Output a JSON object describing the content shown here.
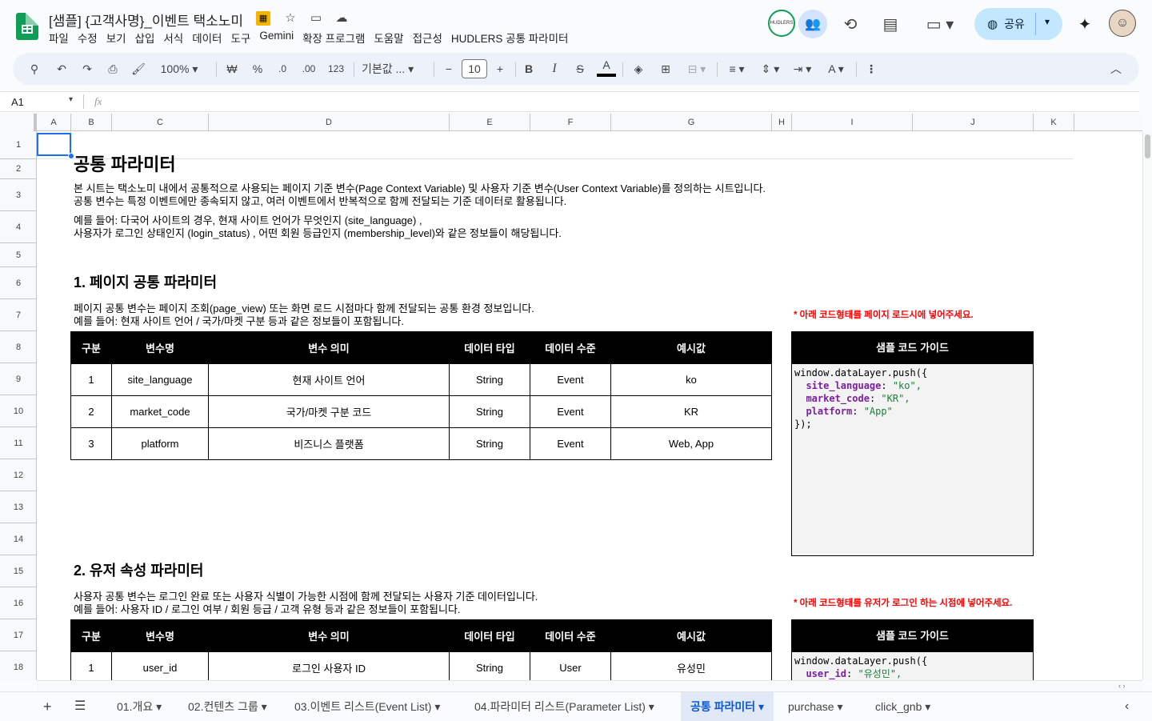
{
  "doc": {
    "title": "[샘플] {고객사명}_이벤트 택소노미"
  },
  "menu": [
    "파일",
    "수정",
    "보기",
    "삽입",
    "서식",
    "데이터",
    "도구",
    "Gemini",
    "확장 프로그램",
    "도움말",
    "접근성",
    "HUDLERS 공통 파라미터"
  ],
  "header_right": {
    "share_label": "공유",
    "avatar_badge": "HUDLERS"
  },
  "toolbar": {
    "zoom": "100%",
    "currency": "₩",
    "percent": "%",
    "dec_less": ".0",
    "dec_more": ".00",
    "format_more": "123",
    "font": "기본값 ...",
    "font_size": "10"
  },
  "formula": {
    "namebox": "A1",
    "fx": "fx"
  },
  "columns": [
    "A",
    "B",
    "C",
    "D",
    "E",
    "F",
    "G",
    "H",
    "I",
    "J",
    "K"
  ],
  "rows": [
    "1",
    "2",
    "3",
    "4",
    "5",
    "6",
    "7",
    "8",
    "9",
    "10",
    "11",
    "12",
    "13",
    "14",
    "15",
    "16",
    "17",
    "18"
  ],
  "content": {
    "title": "공통 파라미터",
    "intro1": "본 시트는 택소노미 내에서 공통적으로 사용되는 페이지 기준 변수(Page Context Variable) 및 사용자 기준 변수(User Context Variable)를 정의하는 시트입니다.",
    "intro2": "공통 변수는 특정 이벤트에만 종속되지 않고, 여러 이벤트에서 반복적으로 함께 전달되는 기준 데이터로 활용됩니다.",
    "example1": "예를 들어: 다국어 사이트의 경우, 현재 사이트 언어가 무엇인지 (site_language) ,",
    "example2": "사용자가 로그인 상태인지 (login_status) , 어떤 회원 등급인지 (membership_level)와 같은 정보들이 해당됩니다.",
    "section1": {
      "heading": "1. 페이지 공통 파라미터",
      "desc1": "페이지 공통 변수는 페이지 조회(page_view) 또는 화면 로드 시점마다 함께 전달되는 공통 환경 정보입니다.",
      "desc2": "예를 들어: 현재 사이트 언어 / 국가/마켓 구분 등과 같은 정보들이 포함됩니다.",
      "note": "* 아래 코드형태를 페이지 로드시에 넣어주세요.",
      "headers": [
        "구분",
        "변수명",
        "변수 의미",
        "데이터 타입",
        "데이터 수준",
        "예시값"
      ],
      "rows": [
        [
          "1",
          "site_language",
          "현재 사이트 언어",
          "String",
          "Event",
          "ko"
        ],
        [
          "2",
          "market_code",
          "국가/마켓 구분 코드",
          "String",
          "Event",
          "KR"
        ],
        [
          "3",
          "platform",
          "비즈니스 플랫폼",
          "String",
          "Event",
          "Web, App"
        ]
      ],
      "code_title": "샘플 코드 가이드",
      "code": {
        "open": "window.dataLayer.push({",
        "lines": [
          [
            "site_language",
            "\"ko\","
          ],
          [
            "market_code",
            "\"KR\","
          ],
          [
            "platform",
            "\"App\""
          ]
        ],
        "close": "});"
      }
    },
    "section2": {
      "heading": "2. 유저 속성 파라미터",
      "desc1": "사용자 공통 변수는 로그인 완료 또는 사용자 식별이 가능한 시점에 함께 전달되는 사용자 기준 데이터입니다.",
      "desc2": "예를 들어: 사용자 ID / 로그인 여부 / 회원 등급 / 고객 유형 등과 같은 정보들이 포함됩니다.",
      "note": "* 아래 코드형태를 유저가 로그인 하는 시점에 넣어주세요.",
      "headers": [
        "구분",
        "변수명",
        "변수 의미",
        "데이터 타입",
        "데이터 수준",
        "예시값"
      ],
      "rows": [
        [
          "1",
          "user_id",
          "로그인 사용자 ID",
          "String",
          "User",
          "유성민"
        ]
      ],
      "code_title": "샘플 코드 가이드",
      "code": {
        "open": "window.dataLayer.push({",
        "lines": [
          [
            "user_id",
            "\"유성민\","
          ]
        ]
      }
    }
  },
  "sheets": [
    "01.개요",
    "02.컨텐츠 그룹",
    "03.이벤트 리스트(Event List)",
    "04.파라미터 리스트(Parameter List)",
    "공통 파라미터",
    "purchase",
    "click_gnb"
  ],
  "active_sheet": "공통 파라미터"
}
